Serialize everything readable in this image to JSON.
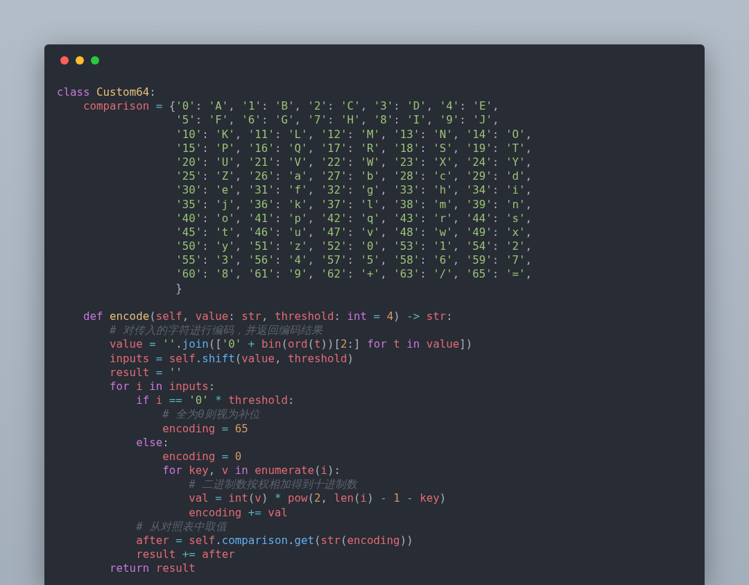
{
  "window": {
    "controls": [
      {
        "color": "#ff5f56"
      },
      {
        "color": "#ffbd2e"
      },
      {
        "color": "#27c93f"
      }
    ]
  },
  "code": {
    "lines": [
      {
        "tokens": [
          {
            "text": "class",
            "kind": "kw"
          },
          {
            "text": " Custom64",
            "kind": "cls"
          },
          {
            "text": ":",
            "kind": "punct"
          }
        ]
      },
      {
        "tokens": [
          {
            "text": "    comparison",
            "kind": "var"
          },
          {
            "text": " = ",
            "kind": "op"
          },
          {
            "text": "{",
            "kind": "punct"
          },
          {
            "text": "'0'",
            "kind": "str"
          },
          {
            "text": ": ",
            "kind": "punct"
          },
          {
            "text": "'A'",
            "kind": "str"
          },
          {
            "text": ", ",
            "kind": "punct"
          },
          {
            "text": "'1'",
            "kind": "str"
          },
          {
            "text": ": ",
            "kind": "punct"
          },
          {
            "text": "'B'",
            "kind": "str"
          },
          {
            "text": ", ",
            "kind": "punct"
          },
          {
            "text": "'2'",
            "kind": "str"
          },
          {
            "text": ": ",
            "kind": "punct"
          },
          {
            "text": "'C'",
            "kind": "str"
          },
          {
            "text": ", ",
            "kind": "punct"
          },
          {
            "text": "'3'",
            "kind": "str"
          },
          {
            "text": ": ",
            "kind": "punct"
          },
          {
            "text": "'D'",
            "kind": "str"
          },
          {
            "text": ", ",
            "kind": "punct"
          },
          {
            "text": "'4'",
            "kind": "str"
          },
          {
            "text": ": ",
            "kind": "punct"
          },
          {
            "text": "'E'",
            "kind": "str"
          },
          {
            "text": ",",
            "kind": "punct"
          }
        ]
      },
      {
        "tokens": [
          {
            "text": "                  '5'",
            "kind": "str"
          },
          {
            "text": ": ",
            "kind": "punct"
          },
          {
            "text": "'F'",
            "kind": "str"
          },
          {
            "text": ", ",
            "kind": "punct"
          },
          {
            "text": "'6'",
            "kind": "str"
          },
          {
            "text": ": ",
            "kind": "punct"
          },
          {
            "text": "'G'",
            "kind": "str"
          },
          {
            "text": ", ",
            "kind": "punct"
          },
          {
            "text": "'7'",
            "kind": "str"
          },
          {
            "text": ": ",
            "kind": "punct"
          },
          {
            "text": "'H'",
            "kind": "str"
          },
          {
            "text": ", ",
            "kind": "punct"
          },
          {
            "text": "'8'",
            "kind": "str"
          },
          {
            "text": ": ",
            "kind": "punct"
          },
          {
            "text": "'I'",
            "kind": "str"
          },
          {
            "text": ", ",
            "kind": "punct"
          },
          {
            "text": "'9'",
            "kind": "str"
          },
          {
            "text": ": ",
            "kind": "punct"
          },
          {
            "text": "'J'",
            "kind": "str"
          },
          {
            "text": ",",
            "kind": "punct"
          }
        ]
      },
      {
        "tokens": [
          {
            "text": "                  '10'",
            "kind": "str"
          },
          {
            "text": ": ",
            "kind": "punct"
          },
          {
            "text": "'K'",
            "kind": "str"
          },
          {
            "text": ", ",
            "kind": "punct"
          },
          {
            "text": "'11'",
            "kind": "str"
          },
          {
            "text": ": ",
            "kind": "punct"
          },
          {
            "text": "'L'",
            "kind": "str"
          },
          {
            "text": ", ",
            "kind": "punct"
          },
          {
            "text": "'12'",
            "kind": "str"
          },
          {
            "text": ": ",
            "kind": "punct"
          },
          {
            "text": "'M'",
            "kind": "str"
          },
          {
            "text": ", ",
            "kind": "punct"
          },
          {
            "text": "'13'",
            "kind": "str"
          },
          {
            "text": ": ",
            "kind": "punct"
          },
          {
            "text": "'N'",
            "kind": "str"
          },
          {
            "text": ", ",
            "kind": "punct"
          },
          {
            "text": "'14'",
            "kind": "str"
          },
          {
            "text": ": ",
            "kind": "punct"
          },
          {
            "text": "'O'",
            "kind": "str"
          },
          {
            "text": ",",
            "kind": "punct"
          }
        ]
      },
      {
        "tokens": [
          {
            "text": "                  '15'",
            "kind": "str"
          },
          {
            "text": ": ",
            "kind": "punct"
          },
          {
            "text": "'P'",
            "kind": "str"
          },
          {
            "text": ", ",
            "kind": "punct"
          },
          {
            "text": "'16'",
            "kind": "str"
          },
          {
            "text": ": ",
            "kind": "punct"
          },
          {
            "text": "'Q'",
            "kind": "str"
          },
          {
            "text": ", ",
            "kind": "punct"
          },
          {
            "text": "'17'",
            "kind": "str"
          },
          {
            "text": ": ",
            "kind": "punct"
          },
          {
            "text": "'R'",
            "kind": "str"
          },
          {
            "text": ", ",
            "kind": "punct"
          },
          {
            "text": "'18'",
            "kind": "str"
          },
          {
            "text": ": ",
            "kind": "punct"
          },
          {
            "text": "'S'",
            "kind": "str"
          },
          {
            "text": ", ",
            "kind": "punct"
          },
          {
            "text": "'19'",
            "kind": "str"
          },
          {
            "text": ": ",
            "kind": "punct"
          },
          {
            "text": "'T'",
            "kind": "str"
          },
          {
            "text": ",",
            "kind": "punct"
          }
        ]
      },
      {
        "tokens": [
          {
            "text": "                  '20'",
            "kind": "str"
          },
          {
            "text": ": ",
            "kind": "punct"
          },
          {
            "text": "'U'",
            "kind": "str"
          },
          {
            "text": ", ",
            "kind": "punct"
          },
          {
            "text": "'21'",
            "kind": "str"
          },
          {
            "text": ": ",
            "kind": "punct"
          },
          {
            "text": "'V'",
            "kind": "str"
          },
          {
            "text": ", ",
            "kind": "punct"
          },
          {
            "text": "'22'",
            "kind": "str"
          },
          {
            "text": ": ",
            "kind": "punct"
          },
          {
            "text": "'W'",
            "kind": "str"
          },
          {
            "text": ", ",
            "kind": "punct"
          },
          {
            "text": "'23'",
            "kind": "str"
          },
          {
            "text": ": ",
            "kind": "punct"
          },
          {
            "text": "'X'",
            "kind": "str"
          },
          {
            "text": ", ",
            "kind": "punct"
          },
          {
            "text": "'24'",
            "kind": "str"
          },
          {
            "text": ": ",
            "kind": "punct"
          },
          {
            "text": "'Y'",
            "kind": "str"
          },
          {
            "text": ",",
            "kind": "punct"
          }
        ]
      },
      {
        "tokens": [
          {
            "text": "                  '25'",
            "kind": "str"
          },
          {
            "text": ": ",
            "kind": "punct"
          },
          {
            "text": "'Z'",
            "kind": "str"
          },
          {
            "text": ", ",
            "kind": "punct"
          },
          {
            "text": "'26'",
            "kind": "str"
          },
          {
            "text": ": ",
            "kind": "punct"
          },
          {
            "text": "'a'",
            "kind": "str"
          },
          {
            "text": ", ",
            "kind": "punct"
          },
          {
            "text": "'27'",
            "kind": "str"
          },
          {
            "text": ": ",
            "kind": "punct"
          },
          {
            "text": "'b'",
            "kind": "str"
          },
          {
            "text": ", ",
            "kind": "punct"
          },
          {
            "text": "'28'",
            "kind": "str"
          },
          {
            "text": ": ",
            "kind": "punct"
          },
          {
            "text": "'c'",
            "kind": "str"
          },
          {
            "text": ", ",
            "kind": "punct"
          },
          {
            "text": "'29'",
            "kind": "str"
          },
          {
            "text": ": ",
            "kind": "punct"
          },
          {
            "text": "'d'",
            "kind": "str"
          },
          {
            "text": ",",
            "kind": "punct"
          }
        ]
      },
      {
        "tokens": [
          {
            "text": "                  '30'",
            "kind": "str"
          },
          {
            "text": ": ",
            "kind": "punct"
          },
          {
            "text": "'e'",
            "kind": "str"
          },
          {
            "text": ", ",
            "kind": "punct"
          },
          {
            "text": "'31'",
            "kind": "str"
          },
          {
            "text": ": ",
            "kind": "punct"
          },
          {
            "text": "'f'",
            "kind": "str"
          },
          {
            "text": ", ",
            "kind": "punct"
          },
          {
            "text": "'32'",
            "kind": "str"
          },
          {
            "text": ": ",
            "kind": "punct"
          },
          {
            "text": "'g'",
            "kind": "str"
          },
          {
            "text": ", ",
            "kind": "punct"
          },
          {
            "text": "'33'",
            "kind": "str"
          },
          {
            "text": ": ",
            "kind": "punct"
          },
          {
            "text": "'h'",
            "kind": "str"
          },
          {
            "text": ", ",
            "kind": "punct"
          },
          {
            "text": "'34'",
            "kind": "str"
          },
          {
            "text": ": ",
            "kind": "punct"
          },
          {
            "text": "'i'",
            "kind": "str"
          },
          {
            "text": ",",
            "kind": "punct"
          }
        ]
      },
      {
        "tokens": [
          {
            "text": "                  '35'",
            "kind": "str"
          },
          {
            "text": ": ",
            "kind": "punct"
          },
          {
            "text": "'j'",
            "kind": "str"
          },
          {
            "text": ", ",
            "kind": "punct"
          },
          {
            "text": "'36'",
            "kind": "str"
          },
          {
            "text": ": ",
            "kind": "punct"
          },
          {
            "text": "'k'",
            "kind": "str"
          },
          {
            "text": ", ",
            "kind": "punct"
          },
          {
            "text": "'37'",
            "kind": "str"
          },
          {
            "text": ": ",
            "kind": "punct"
          },
          {
            "text": "'l'",
            "kind": "str"
          },
          {
            "text": ", ",
            "kind": "punct"
          },
          {
            "text": "'38'",
            "kind": "str"
          },
          {
            "text": ": ",
            "kind": "punct"
          },
          {
            "text": "'m'",
            "kind": "str"
          },
          {
            "text": ", ",
            "kind": "punct"
          },
          {
            "text": "'39'",
            "kind": "str"
          },
          {
            "text": ": ",
            "kind": "punct"
          },
          {
            "text": "'n'",
            "kind": "str"
          },
          {
            "text": ",",
            "kind": "punct"
          }
        ]
      },
      {
        "tokens": [
          {
            "text": "                  '40'",
            "kind": "str"
          },
          {
            "text": ": ",
            "kind": "punct"
          },
          {
            "text": "'o'",
            "kind": "str"
          },
          {
            "text": ", ",
            "kind": "punct"
          },
          {
            "text": "'41'",
            "kind": "str"
          },
          {
            "text": ": ",
            "kind": "punct"
          },
          {
            "text": "'p'",
            "kind": "str"
          },
          {
            "text": ", ",
            "kind": "punct"
          },
          {
            "text": "'42'",
            "kind": "str"
          },
          {
            "text": ": ",
            "kind": "punct"
          },
          {
            "text": "'q'",
            "kind": "str"
          },
          {
            "text": ", ",
            "kind": "punct"
          },
          {
            "text": "'43'",
            "kind": "str"
          },
          {
            "text": ": ",
            "kind": "punct"
          },
          {
            "text": "'r'",
            "kind": "str"
          },
          {
            "text": ", ",
            "kind": "punct"
          },
          {
            "text": "'44'",
            "kind": "str"
          },
          {
            "text": ": ",
            "kind": "punct"
          },
          {
            "text": "'s'",
            "kind": "str"
          },
          {
            "text": ",",
            "kind": "punct"
          }
        ]
      },
      {
        "tokens": [
          {
            "text": "                  '45'",
            "kind": "str"
          },
          {
            "text": ": ",
            "kind": "punct"
          },
          {
            "text": "'t'",
            "kind": "str"
          },
          {
            "text": ", ",
            "kind": "punct"
          },
          {
            "text": "'46'",
            "kind": "str"
          },
          {
            "text": ": ",
            "kind": "punct"
          },
          {
            "text": "'u'",
            "kind": "str"
          },
          {
            "text": ", ",
            "kind": "punct"
          },
          {
            "text": "'47'",
            "kind": "str"
          },
          {
            "text": ": ",
            "kind": "punct"
          },
          {
            "text": "'v'",
            "kind": "str"
          },
          {
            "text": ", ",
            "kind": "punct"
          },
          {
            "text": "'48'",
            "kind": "str"
          },
          {
            "text": ": ",
            "kind": "punct"
          },
          {
            "text": "'w'",
            "kind": "str"
          },
          {
            "text": ", ",
            "kind": "punct"
          },
          {
            "text": "'49'",
            "kind": "str"
          },
          {
            "text": ": ",
            "kind": "punct"
          },
          {
            "text": "'x'",
            "kind": "str"
          },
          {
            "text": ",",
            "kind": "punct"
          }
        ]
      },
      {
        "tokens": [
          {
            "text": "                  '50'",
            "kind": "str"
          },
          {
            "text": ": ",
            "kind": "punct"
          },
          {
            "text": "'y'",
            "kind": "str"
          },
          {
            "text": ", ",
            "kind": "punct"
          },
          {
            "text": "'51'",
            "kind": "str"
          },
          {
            "text": ": ",
            "kind": "punct"
          },
          {
            "text": "'z'",
            "kind": "str"
          },
          {
            "text": ", ",
            "kind": "punct"
          },
          {
            "text": "'52'",
            "kind": "str"
          },
          {
            "text": ": ",
            "kind": "punct"
          },
          {
            "text": "'0'",
            "kind": "str"
          },
          {
            "text": ", ",
            "kind": "punct"
          },
          {
            "text": "'53'",
            "kind": "str"
          },
          {
            "text": ": ",
            "kind": "punct"
          },
          {
            "text": "'1'",
            "kind": "str"
          },
          {
            "text": ", ",
            "kind": "punct"
          },
          {
            "text": "'54'",
            "kind": "str"
          },
          {
            "text": ": ",
            "kind": "punct"
          },
          {
            "text": "'2'",
            "kind": "str"
          },
          {
            "text": ",",
            "kind": "punct"
          }
        ]
      },
      {
        "tokens": [
          {
            "text": "                  '55'",
            "kind": "str"
          },
          {
            "text": ": ",
            "kind": "punct"
          },
          {
            "text": "'3'",
            "kind": "str"
          },
          {
            "text": ", ",
            "kind": "punct"
          },
          {
            "text": "'56'",
            "kind": "str"
          },
          {
            "text": ": ",
            "kind": "punct"
          },
          {
            "text": "'4'",
            "kind": "str"
          },
          {
            "text": ", ",
            "kind": "punct"
          },
          {
            "text": "'57'",
            "kind": "str"
          },
          {
            "text": ": ",
            "kind": "punct"
          },
          {
            "text": "'5'",
            "kind": "str"
          },
          {
            "text": ", ",
            "kind": "punct"
          },
          {
            "text": "'58'",
            "kind": "str"
          },
          {
            "text": ": ",
            "kind": "punct"
          },
          {
            "text": "'6'",
            "kind": "str"
          },
          {
            "text": ", ",
            "kind": "punct"
          },
          {
            "text": "'59'",
            "kind": "str"
          },
          {
            "text": ": ",
            "kind": "punct"
          },
          {
            "text": "'7'",
            "kind": "str"
          },
          {
            "text": ",",
            "kind": "punct"
          }
        ]
      },
      {
        "tokens": [
          {
            "text": "                  '60'",
            "kind": "str"
          },
          {
            "text": ": ",
            "kind": "punct"
          },
          {
            "text": "'8'",
            "kind": "str"
          },
          {
            "text": ", ",
            "kind": "punct"
          },
          {
            "text": "'61'",
            "kind": "str"
          },
          {
            "text": ": ",
            "kind": "punct"
          },
          {
            "text": "'9'",
            "kind": "str"
          },
          {
            "text": ", ",
            "kind": "punct"
          },
          {
            "text": "'62'",
            "kind": "str"
          },
          {
            "text": ": ",
            "kind": "punct"
          },
          {
            "text": "'+'",
            "kind": "str"
          },
          {
            "text": ", ",
            "kind": "punct"
          },
          {
            "text": "'63'",
            "kind": "str"
          },
          {
            "text": ": ",
            "kind": "punct"
          },
          {
            "text": "'/'",
            "kind": "str"
          },
          {
            "text": ", ",
            "kind": "punct"
          },
          {
            "text": "'65'",
            "kind": "str"
          },
          {
            "text": ": ",
            "kind": "punct"
          },
          {
            "text": "'='",
            "kind": "str"
          },
          {
            "text": ",",
            "kind": "punct"
          }
        ]
      },
      {
        "tokens": [
          {
            "text": "                  }",
            "kind": "punct"
          }
        ]
      },
      {
        "kind": "blank"
      },
      {
        "tokens": [
          {
            "text": "    def",
            "kind": "kw"
          },
          {
            "text": " encode",
            "kind": "cls"
          },
          {
            "text": "(",
            "kind": "punct"
          },
          {
            "text": "self",
            "kind": "var"
          },
          {
            "text": ", ",
            "kind": "punct"
          },
          {
            "text": "value",
            "kind": "var"
          },
          {
            "text": ": ",
            "kind": "punct"
          },
          {
            "text": "str",
            "kind": "var"
          },
          {
            "text": ", ",
            "kind": "punct"
          },
          {
            "text": "threshold",
            "kind": "var"
          },
          {
            "text": ": ",
            "kind": "punct"
          },
          {
            "text": "int",
            "kind": "kw"
          },
          {
            "text": " = ",
            "kind": "op"
          },
          {
            "text": "4",
            "kind": "num"
          },
          {
            "text": ") ",
            "kind": "punct"
          },
          {
            "text": "->",
            "kind": "op"
          },
          {
            "text": " str",
            "kind": "var"
          },
          {
            "text": ":",
            "kind": "punct"
          }
        ]
      },
      {
        "tokens": [
          {
            "text": "        # 对传入的字符进行编码，并返回编码结果",
            "kind": "cmt"
          }
        ]
      },
      {
        "tokens": [
          {
            "text": "        value",
            "kind": "var"
          },
          {
            "text": " = ",
            "kind": "op"
          },
          {
            "text": "''",
            "kind": "str"
          },
          {
            "text": ".",
            "kind": "punct"
          },
          {
            "text": "join",
            "kind": "fn"
          },
          {
            "text": "([",
            "kind": "punct"
          },
          {
            "text": "'0'",
            "kind": "str"
          },
          {
            "text": " + ",
            "kind": "op"
          },
          {
            "text": "bin",
            "kind": "var"
          },
          {
            "text": "(",
            "kind": "punct"
          },
          {
            "text": "ord",
            "kind": "var"
          },
          {
            "text": "(",
            "kind": "punct"
          },
          {
            "text": "t",
            "kind": "var"
          },
          {
            "text": "))[",
            "kind": "punct"
          },
          {
            "text": "2",
            "kind": "num"
          },
          {
            "text": ":] ",
            "kind": "punct"
          },
          {
            "text": "for",
            "kind": "kw"
          },
          {
            "text": " t ",
            "kind": "var"
          },
          {
            "text": "in",
            "kind": "kw"
          },
          {
            "text": " value",
            "kind": "var"
          },
          {
            "text": "])",
            "kind": "punct"
          }
        ]
      },
      {
        "tokens": [
          {
            "text": "        inputs",
            "kind": "var"
          },
          {
            "text": " = ",
            "kind": "op"
          },
          {
            "text": "self",
            "kind": "var"
          },
          {
            "text": ".",
            "kind": "punct"
          },
          {
            "text": "shift",
            "kind": "fn"
          },
          {
            "text": "(",
            "kind": "punct"
          },
          {
            "text": "value",
            "kind": "var"
          },
          {
            "text": ", ",
            "kind": "punct"
          },
          {
            "text": "threshold",
            "kind": "var"
          },
          {
            "text": ")",
            "kind": "punct"
          }
        ]
      },
      {
        "tokens": [
          {
            "text": "        result",
            "kind": "var"
          },
          {
            "text": " = ",
            "kind": "op"
          },
          {
            "text": "''",
            "kind": "str"
          }
        ]
      },
      {
        "tokens": [
          {
            "text": "        for",
            "kind": "kw"
          },
          {
            "text": " i ",
            "kind": "var"
          },
          {
            "text": "in",
            "kind": "kw"
          },
          {
            "text": " inputs",
            "kind": "var"
          },
          {
            "text": ":",
            "kind": "punct"
          }
        ]
      },
      {
        "tokens": [
          {
            "text": "            if",
            "kind": "kw"
          },
          {
            "text": " i ",
            "kind": "var"
          },
          {
            "text": "== ",
            "kind": "op"
          },
          {
            "text": "'0'",
            "kind": "str"
          },
          {
            "text": " * ",
            "kind": "op"
          },
          {
            "text": "threshold",
            "kind": "var"
          },
          {
            "text": ":",
            "kind": "punct"
          }
        ]
      },
      {
        "tokens": [
          {
            "text": "                # 全为0则视为补位",
            "kind": "cmt"
          }
        ]
      },
      {
        "tokens": [
          {
            "text": "                encoding",
            "kind": "var"
          },
          {
            "text": " = ",
            "kind": "op"
          },
          {
            "text": "65",
            "kind": "num"
          }
        ]
      },
      {
        "tokens": [
          {
            "text": "            else",
            "kind": "kw"
          },
          {
            "text": ":",
            "kind": "punct"
          }
        ]
      },
      {
        "tokens": [
          {
            "text": "                encoding",
            "kind": "var"
          },
          {
            "text": " = ",
            "kind": "op"
          },
          {
            "text": "0",
            "kind": "num"
          }
        ]
      },
      {
        "tokens": [
          {
            "text": "                for",
            "kind": "kw"
          },
          {
            "text": " key",
            "kind": "var"
          },
          {
            "text": ", ",
            "kind": "punct"
          },
          {
            "text": "v ",
            "kind": "var"
          },
          {
            "text": "in",
            "kind": "kw"
          },
          {
            "text": " enumerate",
            "kind": "var"
          },
          {
            "text": "(",
            "kind": "punct"
          },
          {
            "text": "i",
            "kind": "var"
          },
          {
            "text": "):",
            "kind": "punct"
          }
        ]
      },
      {
        "tokens": [
          {
            "text": "                    # 二进制数按权相加得到十进制数",
            "kind": "cmt"
          }
        ]
      },
      {
        "tokens": [
          {
            "text": "                    val",
            "kind": "var"
          },
          {
            "text": " = ",
            "kind": "op"
          },
          {
            "text": "int",
            "kind": "var"
          },
          {
            "text": "(",
            "kind": "punct"
          },
          {
            "text": "v",
            "kind": "var"
          },
          {
            "text": ")",
            "kind": "punct"
          },
          {
            "text": " * ",
            "kind": "op"
          },
          {
            "text": "pow",
            "kind": "var"
          },
          {
            "text": "(",
            "kind": "punct"
          },
          {
            "text": "2",
            "kind": "num"
          },
          {
            "text": ", ",
            "kind": "punct"
          },
          {
            "text": "len",
            "kind": "var"
          },
          {
            "text": "(",
            "kind": "punct"
          },
          {
            "text": "i",
            "kind": "var"
          },
          {
            "text": ")",
            "kind": "punct"
          },
          {
            "text": " - ",
            "kind": "op"
          },
          {
            "text": "1",
            "kind": "num"
          },
          {
            "text": " - ",
            "kind": "op"
          },
          {
            "text": "key",
            "kind": "var"
          },
          {
            "text": ")",
            "kind": "punct"
          }
        ]
      },
      {
        "tokens": [
          {
            "text": "                    encoding",
            "kind": "var"
          },
          {
            "text": " += ",
            "kind": "op"
          },
          {
            "text": "val",
            "kind": "var"
          }
        ]
      },
      {
        "tokens": [
          {
            "text": "            # 从对照表中取值",
            "kind": "cmt"
          }
        ]
      },
      {
        "tokens": [
          {
            "text": "            after",
            "kind": "var"
          },
          {
            "text": " = ",
            "kind": "op"
          },
          {
            "text": "self",
            "kind": "var"
          },
          {
            "text": ".",
            "kind": "punct"
          },
          {
            "text": "comparison",
            "kind": "fn"
          },
          {
            "text": ".",
            "kind": "punct"
          },
          {
            "text": "get",
            "kind": "fn"
          },
          {
            "text": "(",
            "kind": "punct"
          },
          {
            "text": "str",
            "kind": "var"
          },
          {
            "text": "(",
            "kind": "punct"
          },
          {
            "text": "encoding",
            "kind": "var"
          },
          {
            "text": "))",
            "kind": "punct"
          }
        ]
      },
      {
        "tokens": [
          {
            "text": "            result",
            "kind": "var"
          },
          {
            "text": " += ",
            "kind": "op"
          },
          {
            "text": "after",
            "kind": "var"
          }
        ]
      },
      {
        "tokens": [
          {
            "text": "        return",
            "kind": "kw"
          },
          {
            "text": " result",
            "kind": "var"
          }
        ]
      }
    ]
  }
}
